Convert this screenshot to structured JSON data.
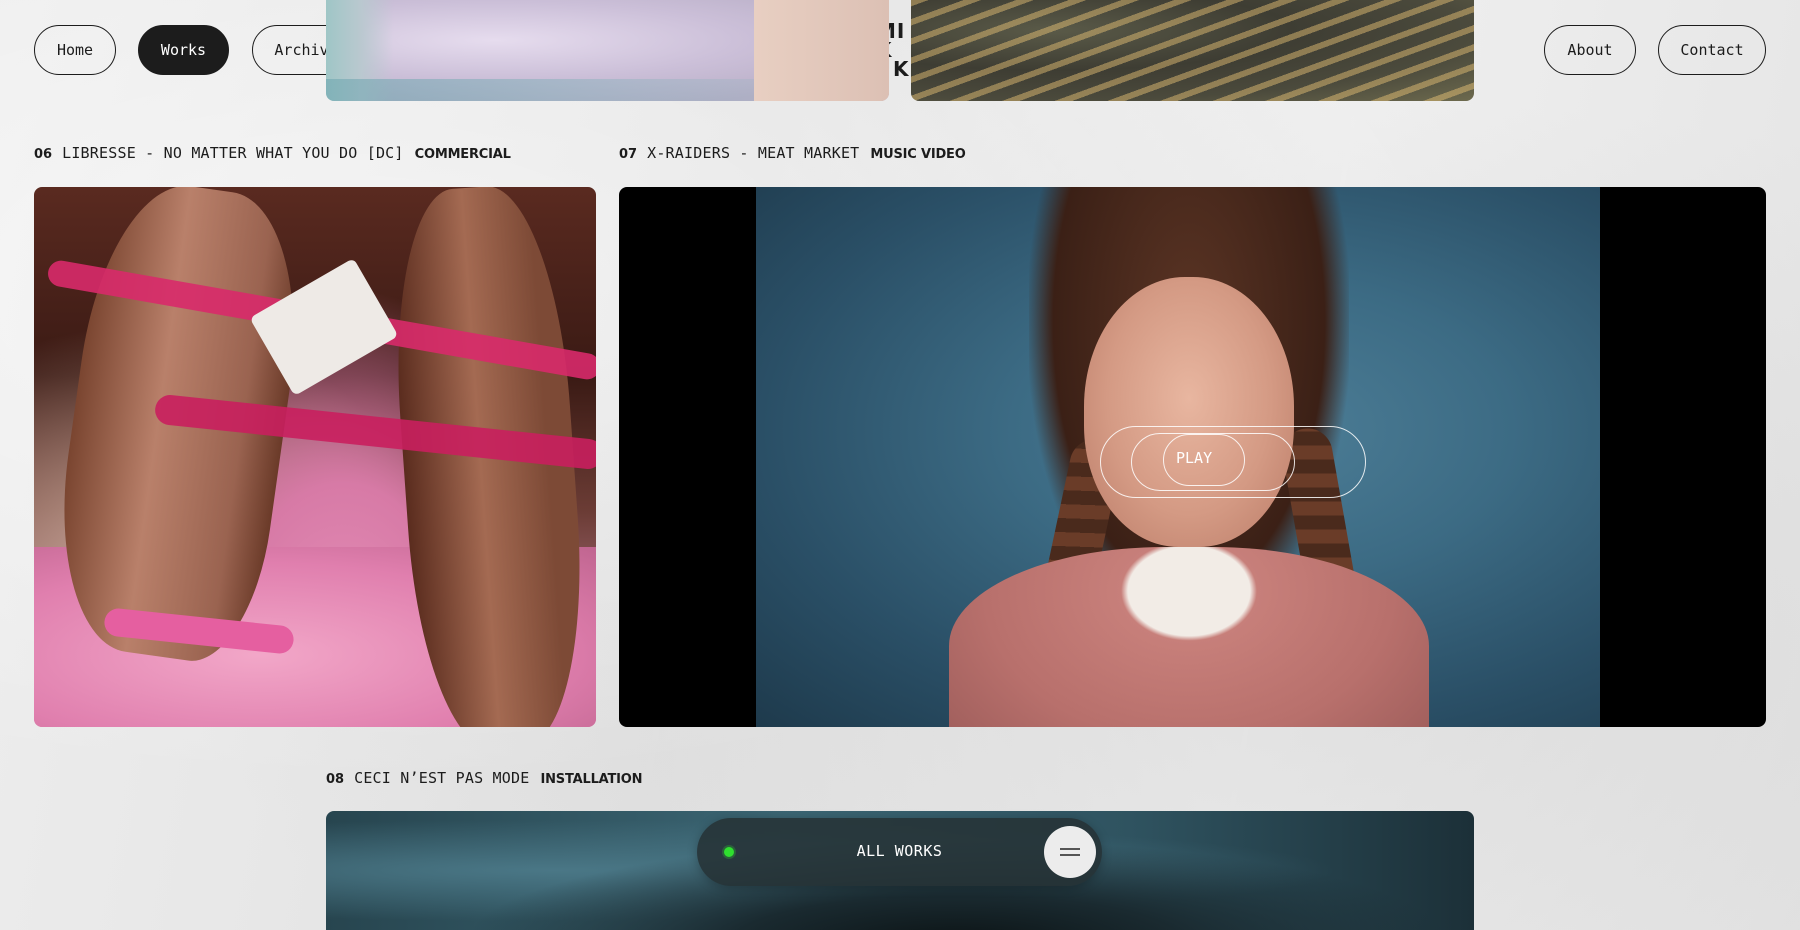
{
  "nav": {
    "home": "Home",
    "works": "Works",
    "archive": "Archive",
    "about": "About",
    "contact": "Contact",
    "active": "Works"
  },
  "logo": {
    "line1": "MI",
    "line2": "K",
    "line3": "KI"
  },
  "works": [
    {
      "number": "06",
      "title": "LIBRESSE - NO MATTER WHAT YOU DO [DC]",
      "category": "COMMERCIAL"
    },
    {
      "number": "07",
      "title": "X-RAIDERS - MEAT MARKET",
      "category": "MUSIC VIDEO"
    },
    {
      "number": "08",
      "title": "CECI N’EST PAS MODE",
      "category": "INSTALLATION"
    }
  ],
  "player": {
    "play_label": "PLAY"
  },
  "bottom_bar": {
    "label": "ALL WORKS",
    "status_color": "#2fe02f",
    "menu_icon": "menu-icon"
  },
  "colors": {
    "ink": "#1c1c1c",
    "background": "#e9e9e9",
    "active_nav_bg": "#1c1c1c",
    "bar_bg": "#263236"
  }
}
